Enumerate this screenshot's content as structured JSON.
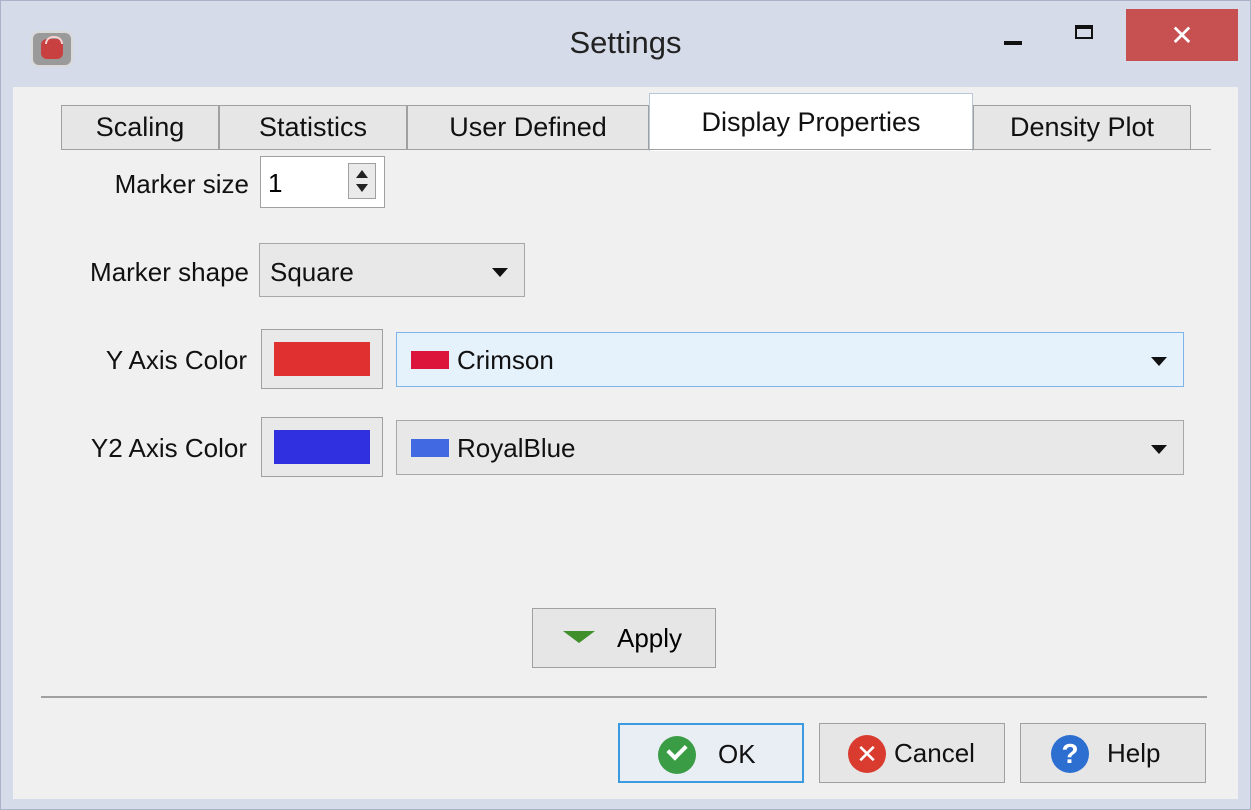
{
  "window": {
    "title": "Settings",
    "close_glyph": "✕"
  },
  "tabs": [
    {
      "label": "Scaling"
    },
    {
      "label": "Statistics"
    },
    {
      "label": "User Defined"
    },
    {
      "label": "Display Properties",
      "active": true
    },
    {
      "label": "Density Plot"
    }
  ],
  "display_properties": {
    "marker_size_label": "Marker size",
    "marker_size_value": "1",
    "marker_shape_label": "Marker shape",
    "marker_shape_value": "Square",
    "y_axis_color_label": "Y Axis Color",
    "y_axis_color_swatch": "#e03030",
    "y_axis_color_value": "Crimson",
    "y_axis_color_value_swatch": "#dc143c",
    "y2_axis_color_label": "Y2 Axis Color",
    "y2_axis_color_swatch": "#3030e0",
    "y2_axis_color_value": "RoyalBlue",
    "y2_axis_color_value_swatch": "#4169e1",
    "apply_label": "Apply"
  },
  "footer": {
    "ok_label": "OK",
    "cancel_label": "Cancel",
    "help_label": "Help",
    "cancel_glyph": "✕",
    "help_glyph": "?"
  }
}
